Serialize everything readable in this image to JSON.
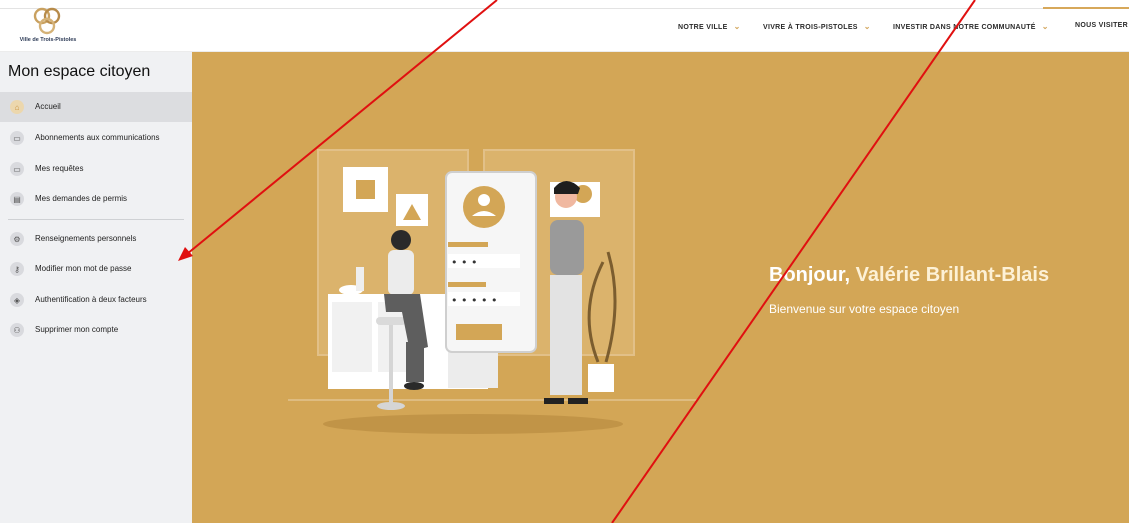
{
  "header": {
    "logo_text": "Ville de Trois-Pistoles",
    "nav": [
      {
        "label": "NOTRE VILLE"
      },
      {
        "label": "VIVRE À TROIS-PISTOLES"
      },
      {
        "label": "INVESTIR DANS NOTRE COMMUNAUTÉ"
      },
      {
        "label": "NOUS VISITER"
      }
    ]
  },
  "sidebar": {
    "title": "Mon espace citoyen",
    "items": [
      {
        "label": "Accueil",
        "icon": "home-icon"
      },
      {
        "label": "Abonnements aux communications",
        "icon": "chat-icon"
      },
      {
        "label": "Mes requêtes",
        "icon": "chat-icon"
      },
      {
        "label": "Mes demandes de permis",
        "icon": "permit-icon"
      },
      {
        "label": "Renseignements personnels",
        "icon": "gear-icon"
      },
      {
        "label": "Modifier mon mot de passe",
        "icon": "key-icon"
      },
      {
        "label": "Authentification à deux facteurs",
        "icon": "shield-icon"
      },
      {
        "label": "Supprimer mon compte",
        "icon": "remove-user-icon"
      }
    ]
  },
  "hero": {
    "greeting_prefix": "Bonjour,",
    "user_name": "Valérie Brillant-Blais",
    "welcome": "Bienvenue sur votre espace citoyen",
    "password_mask_1": "• • •",
    "password_mask_2": "• • • • •"
  },
  "colors": {
    "accent": "#d3a656",
    "sidebar_bg": "#f0f1f3",
    "annotation": "#e01010"
  }
}
